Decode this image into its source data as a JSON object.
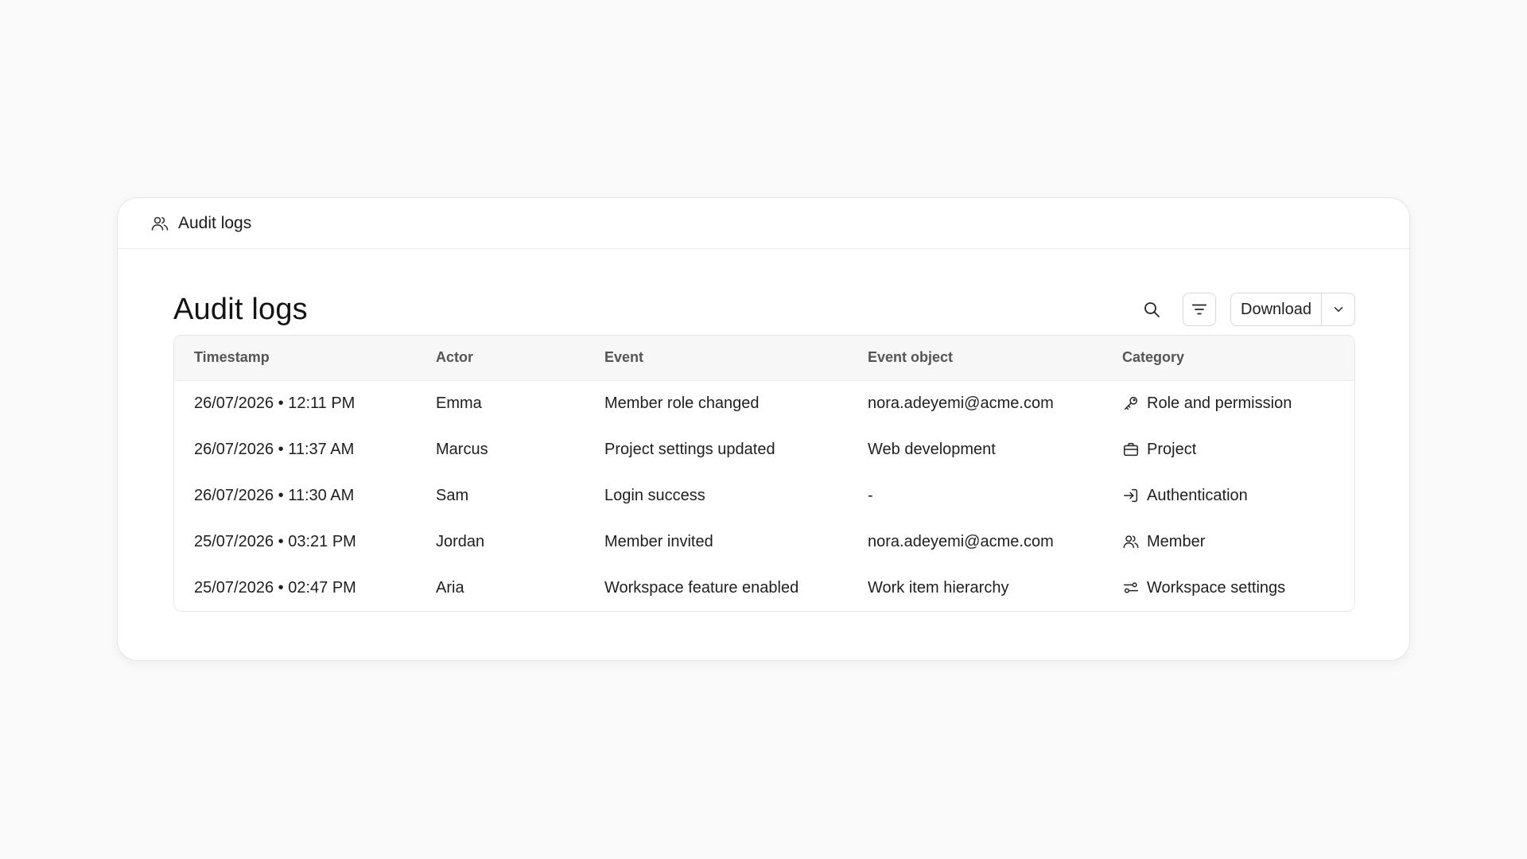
{
  "header": {
    "title": "Audit logs",
    "icon": "users-icon"
  },
  "page": {
    "title": "Audit logs"
  },
  "toolbar": {
    "search_icon": "search-icon",
    "filter_icon": "filter-icon",
    "download_label": "Download",
    "dropdown_icon": "chevron-down-icon"
  },
  "table": {
    "columns": [
      "Timestamp",
      "Actor",
      "Event",
      "Event object",
      "Category"
    ],
    "rows": [
      {
        "timestamp": "26/07/2026 • 12:11 PM",
        "actor": "Emma",
        "event": "Member role changed",
        "object": "nora.adeyemi@acme.com",
        "category": "Role and permission",
        "category_icon": "key-icon"
      },
      {
        "timestamp": "26/07/2026 • 11:37 AM",
        "actor": "Marcus",
        "event": "Project settings updated",
        "object": "Web development",
        "category": "Project",
        "category_icon": "briefcase-icon"
      },
      {
        "timestamp": "26/07/2026 • 11:30 AM",
        "actor": "Sam",
        "event": "Login success",
        "object": "-",
        "category": "Authentication",
        "category_icon": "login-icon"
      },
      {
        "timestamp": "25/07/2026 • 03:21 PM",
        "actor": "Jordan",
        "event": "Member invited",
        "object": "nora.adeyemi@acme.com",
        "category": "Member",
        "category_icon": "users-icon"
      },
      {
        "timestamp": "25/07/2026 • 02:47 PM",
        "actor": "Aria",
        "event": "Workspace feature enabled",
        "object": "Work item hierarchy",
        "category": "Workspace settings",
        "category_icon": "settings-sliders-icon"
      }
    ]
  }
}
